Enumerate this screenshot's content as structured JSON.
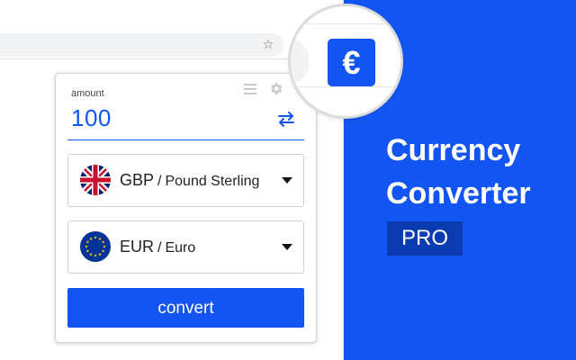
{
  "browser": {
    "star_icon": "star-icon"
  },
  "popup": {
    "amount_label": "amount",
    "amount_value": "100",
    "from": {
      "code": "GBP",
      "separator": "/",
      "name": "Pound Sterling",
      "flag": "uk-flag"
    },
    "to": {
      "code": "EUR",
      "separator": "/",
      "name": "Euro",
      "flag": "eu-flag"
    },
    "convert_label": "convert"
  },
  "extension_icon": {
    "symbol": "€"
  },
  "promo": {
    "title_line1": "Currency",
    "title_line2": "Converter",
    "badge": "PRO"
  },
  "colors": {
    "brand_blue": "#1355f2",
    "badge_blue": "#0a3bb0"
  }
}
